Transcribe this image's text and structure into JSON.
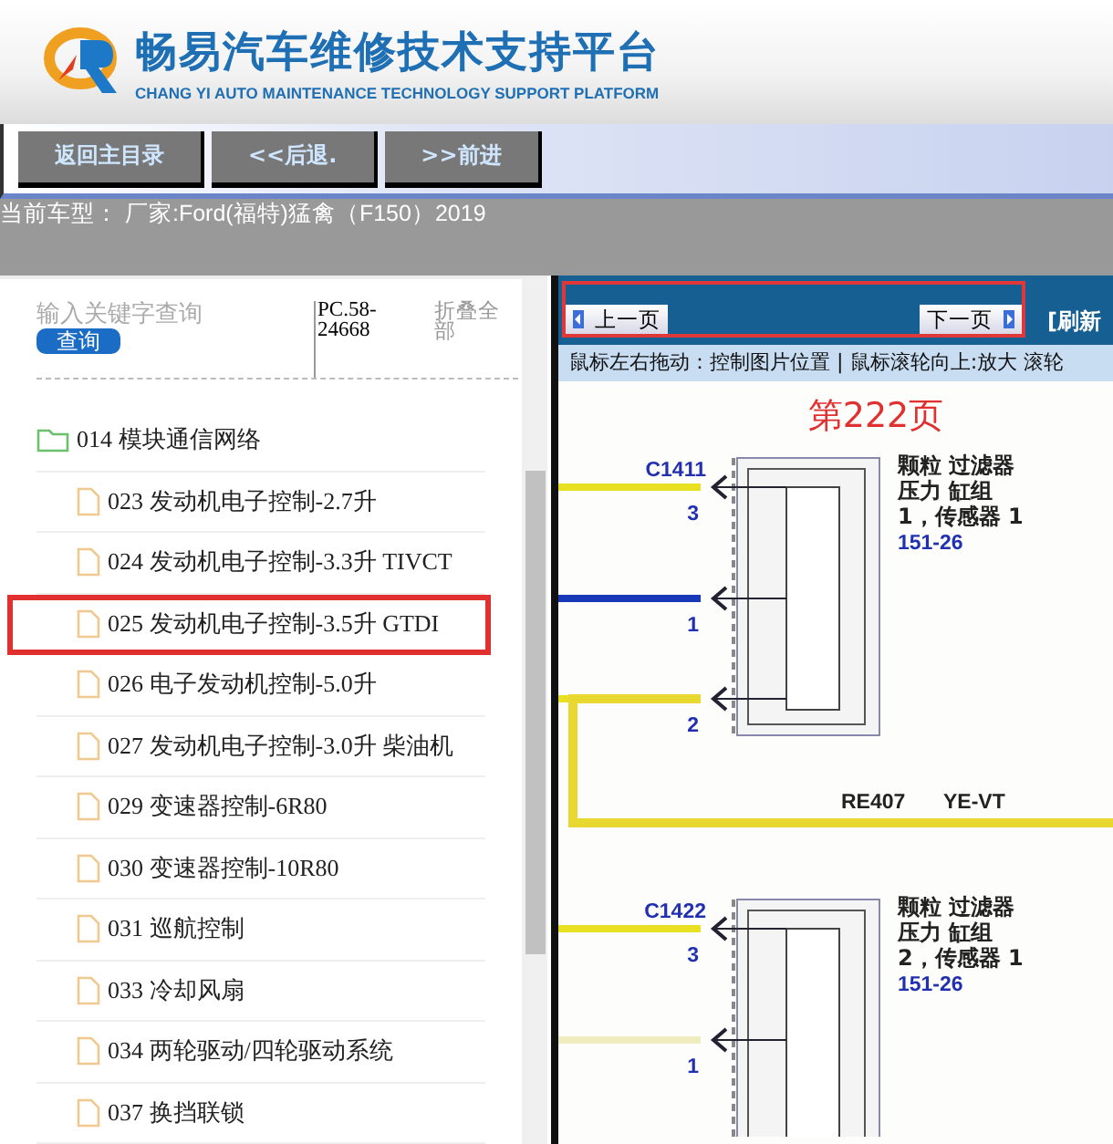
{
  "header": {
    "title": "畅易汽车维修技术支持平台",
    "subtitle": "CHANG YI AUTO MAINTENANCE TECHNOLOGY SUPPORT PLATFORM"
  },
  "toolbar": {
    "buttons": [
      "返回主目录",
      "<<后退.",
      ">>前进"
    ]
  },
  "current_model": "当前车型：  厂家:Ford(福特)猛禽（F150）2019",
  "sidebar": {
    "search": {
      "placeholder": "输入关键字查询"
    },
    "search_button": "查询",
    "code": "PC.58-24668",
    "collapse_link": "折叠全部",
    "tree": [
      {
        "label": "014 模块通信网络",
        "kind": "folder",
        "expanded": true,
        "selected": false,
        "children": [
          {
            "label": "023 发动机电子控制-2.7升",
            "kind": "file",
            "selected": false
          },
          {
            "label": "024 发动机电子控制-3.3升 TIVCT",
            "kind": "file",
            "selected": false
          },
          {
            "label": "025 发动机电子控制-3.5升 GTDI",
            "kind": "file",
            "selected": true
          },
          {
            "label": "026 电子发动机控制-5.0升",
            "kind": "file",
            "selected": false
          },
          {
            "label": "027 发动机电子控制-3.0升 柴油机",
            "kind": "file",
            "selected": false
          },
          {
            "label": "029 变速器控制-6R80",
            "kind": "file",
            "selected": false
          },
          {
            "label": "030 变速器控制-10R80",
            "kind": "file",
            "selected": false
          },
          {
            "label": "031 巡航控制",
            "kind": "file",
            "selected": false
          },
          {
            "label": "033 冷却风扇",
            "kind": "file",
            "selected": false
          },
          {
            "label": "034 两轮驱动/四轮驱动系统",
            "kind": "file",
            "selected": false
          },
          {
            "label": "037 换挡联锁",
            "kind": "file",
            "selected": false
          }
        ]
      }
    ]
  },
  "viewer": {
    "prev_button": "上一页",
    "next_button": "下一页",
    "refresh_link": "[刷新",
    "hint": "鼠标左右拖动：控制图片位置 | 鼠标滚轮向上:放大  滚轮",
    "diagram": {
      "page_label": "第222页",
      "components": [
        {
          "connector": "C1411",
          "label_lines": [
            "颗粒 过滤器",
            "压力 缸组",
            "1，传感器 1"
          ],
          "ref": "151-26",
          "pins": [
            {
              "number": "3",
              "color": "#e8e020"
            },
            {
              "number": "1",
              "color": "#1838b8"
            },
            {
              "number": "2",
              "color": "#e8e020"
            }
          ]
        },
        {
          "connector": "C1422",
          "label_lines": [
            "颗粒 过滤器",
            "压力 缸组",
            "2，传感器 1"
          ],
          "ref": "151-26",
          "pins": [
            {
              "number": "3",
              "color": "#e8e020"
            },
            {
              "number": "1",
              "color": "#f0ecc0"
            }
          ]
        }
      ],
      "wire_labels": [
        "RE407",
        "YE-VT"
      ]
    }
  }
}
